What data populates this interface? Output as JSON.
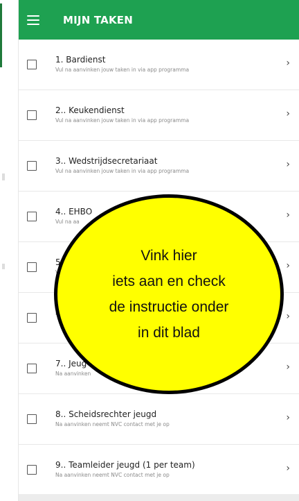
{
  "appbar": {
    "title": "MIJN TAKEN"
  },
  "tasks": [
    {
      "title": "1. Bardienst",
      "subtitle": "Vul na aanvinken jouw taken in via app programma"
    },
    {
      "title": "2.. Keukendienst",
      "subtitle": "Vul na aanvinken jouw taken in via app programma"
    },
    {
      "title": "3.. Wedstrijdsecretariaat",
      "subtitle": "Vul na aanvinken jouw taken in via app programma"
    },
    {
      "title": "4.. EHBO",
      "subtitle": "Vul na aa"
    },
    {
      "title": "5.",
      "subtitle": "V"
    },
    {
      "title": "",
      "subtitle": "N"
    },
    {
      "title": "7.. Jeug",
      "subtitle": "Na aanvinken"
    },
    {
      "title": "8.. Scheidsrechter jeugd",
      "subtitle": "Na aanvinken neemt NVC contact met je op"
    },
    {
      "title": "9.. Teamleider jeugd (1 per team)",
      "subtitle": "Na aanvinken neemt NVC contact met je op"
    }
  ],
  "bubble": {
    "lines": [
      "Vink hier",
      "iets aan en check",
      "de instructie onder",
      "in dit blad"
    ]
  },
  "colors": {
    "accent": "#1ea151",
    "bubble": "#ffff00"
  },
  "icons": {
    "menu": "hamburger-menu-icon",
    "row_arrow": "chevron-right-icon"
  }
}
